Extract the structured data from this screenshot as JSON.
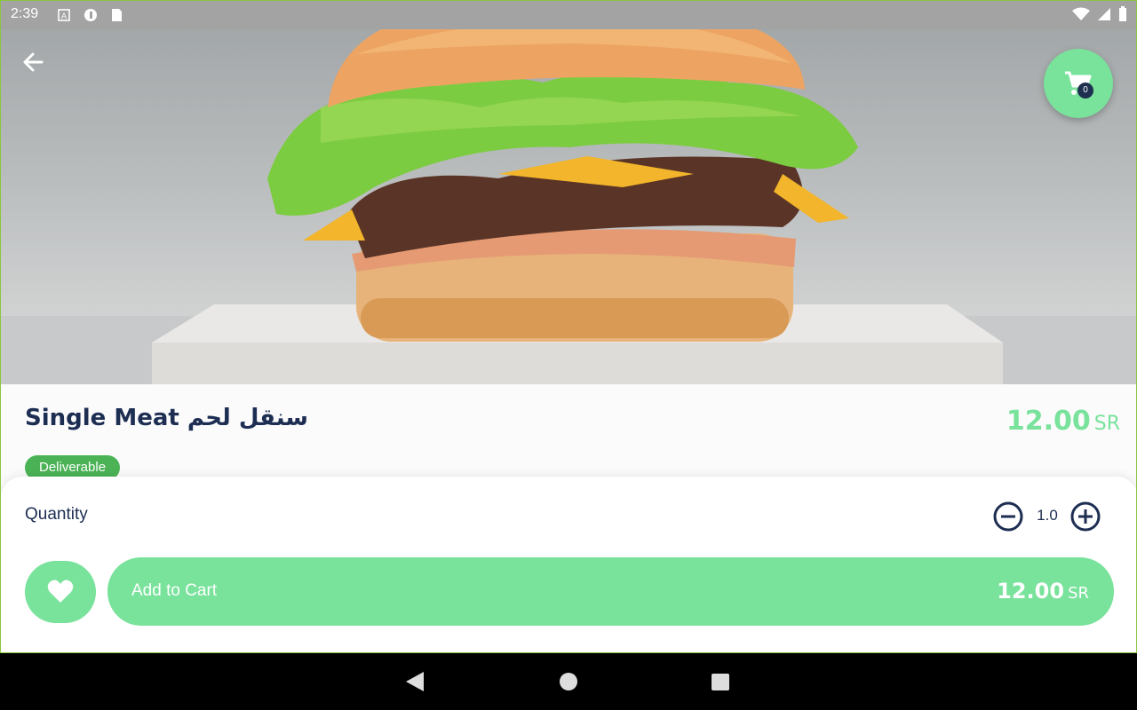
{
  "status_bar": {
    "time": "2:39"
  },
  "header": {
    "cart_count": "0"
  },
  "product": {
    "title": "Single Meat سنقل لحم",
    "price": "12.00",
    "currency": "SR",
    "badge": "Deliverable"
  },
  "quantity": {
    "label": "Quantity",
    "value": "1.0"
  },
  "actions": {
    "add_to_cart_label": "Add to Cart",
    "price": "12.00",
    "currency": "SR"
  },
  "colors": {
    "accent": "#79e29b",
    "primary_text": "#1d2e52",
    "badge": "#4bb356"
  }
}
